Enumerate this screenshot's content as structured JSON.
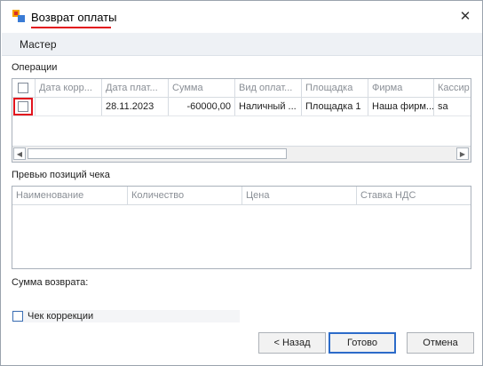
{
  "window": {
    "title": "Возврат оплаты",
    "close_glyph": "✕",
    "icon": "app-icon"
  },
  "wizard": {
    "title": "Мастер"
  },
  "operations": {
    "label": "Операции",
    "columns": [
      "",
      "Дата корр...",
      "Дата плат...",
      "Сумма",
      "Вид оплат...",
      "Площадка",
      "Фирма",
      "Кассир"
    ],
    "rows": [
      {
        "checked": false,
        "correction_date": "",
        "payment_date": "28.11.2023",
        "amount": "-60000,00",
        "payment_type": "Наличный ...",
        "site": "Площадка 1",
        "company": "Наша фирм...",
        "cashier": "sa"
      }
    ],
    "scroll_left": "◀",
    "scroll_right": "▶"
  },
  "preview": {
    "label": "Превью позиций чека",
    "columns": [
      "Наименование",
      "Количество",
      "Цена",
      "Ставка НДС"
    ]
  },
  "refund_sum": {
    "label": "Сумма возврата:"
  },
  "correction": {
    "label": "Чек коррекции",
    "checked": false
  },
  "buttons": {
    "back": "< Назад",
    "done": "Готово",
    "cancel": "Отмена"
  },
  "colors": {
    "highlight": "#e2131d",
    "accent": "#2c6bc9"
  }
}
